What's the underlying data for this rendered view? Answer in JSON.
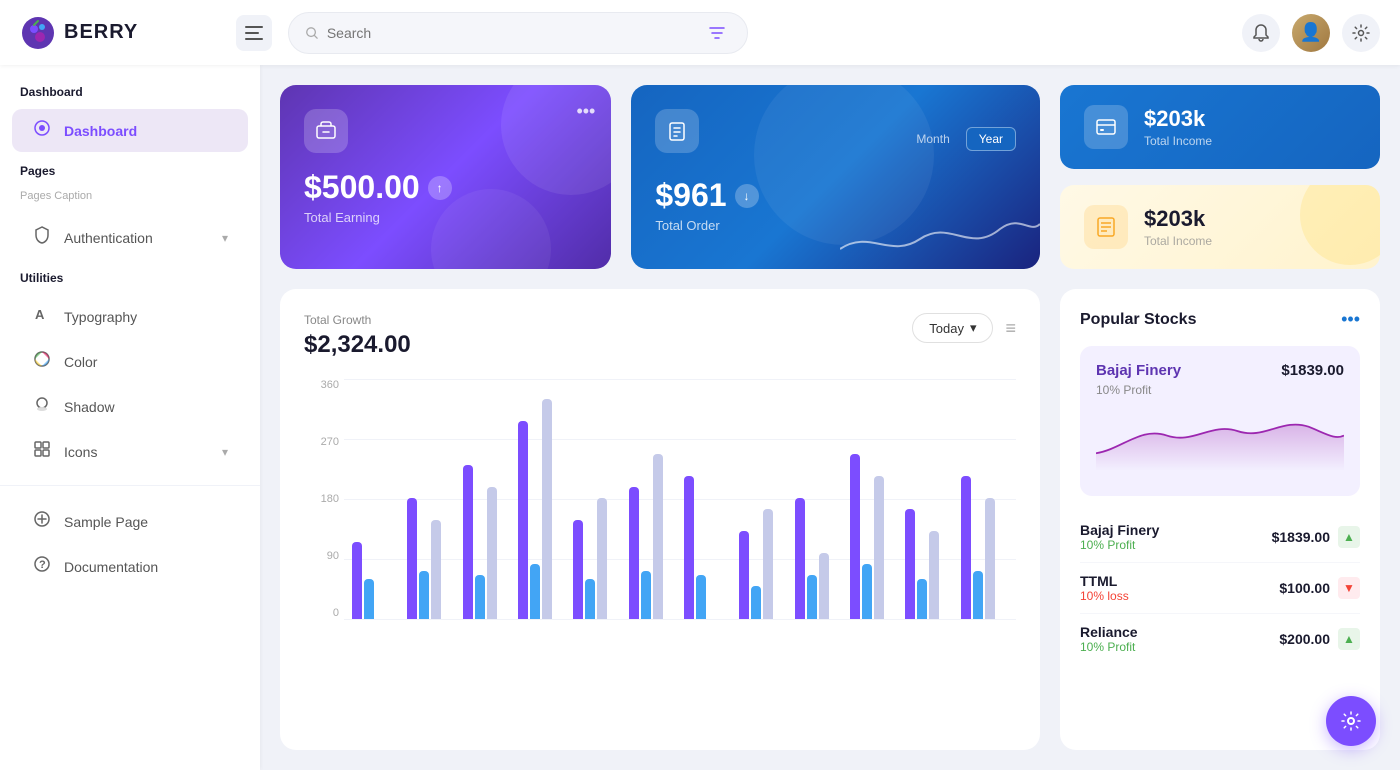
{
  "app": {
    "name": "BERRY",
    "logo_emoji": "🫐"
  },
  "header": {
    "search_placeholder": "Search",
    "menu_label": "☰"
  },
  "sidebar": {
    "dashboard_section": "Dashboard",
    "dashboard_item": "Dashboard",
    "pages_section": "Pages",
    "pages_caption": "Pages Caption",
    "auth_item": "Authentication",
    "utilities_section": "Utilities",
    "typography_item": "Typography",
    "color_item": "Color",
    "shadow_item": "Shadow",
    "icons_item": "Icons",
    "sample_page_item": "Sample Page",
    "documentation_item": "Documentation"
  },
  "cards": {
    "earning_amount": "$500.00",
    "earning_label": "Total Earning",
    "order_amount": "$961",
    "order_label": "Total Order",
    "month_label": "Month",
    "year_label": "Year",
    "income_blue_amount": "$203k",
    "income_blue_label": "Total Income",
    "income_yellow_amount": "$203k",
    "income_yellow_label": "Total Income"
  },
  "chart": {
    "subtitle": "Total Growth",
    "total": "$2,324.00",
    "today_btn": "Today",
    "y_labels": [
      "360",
      "270",
      "180",
      "90"
    ],
    "menu_icon": "≡"
  },
  "stocks": {
    "title": "Popular Stocks",
    "featured_name": "Bajaj Finery",
    "featured_price": "$1839.00",
    "featured_profit": "10% Profit",
    "items": [
      {
        "name": "Bajaj Finery",
        "price": "$1839.00",
        "profit": "10% Profit",
        "trend": "up"
      },
      {
        "name": "TTML",
        "price": "$100.00",
        "profit": "10% loss",
        "trend": "down"
      },
      {
        "name": "Reliance",
        "price": "$200.00",
        "profit": "10% Profit",
        "trend": "up"
      }
    ]
  },
  "bars": [
    {
      "purple": 35,
      "blue": 18,
      "light": 0
    },
    {
      "purple": 55,
      "blue": 22,
      "light": 45
    },
    {
      "purple": 70,
      "blue": 20,
      "light": 60
    },
    {
      "purple": 90,
      "blue": 25,
      "light": 100
    },
    {
      "purple": 45,
      "blue": 18,
      "light": 55
    },
    {
      "purple": 60,
      "blue": 22,
      "light": 75
    },
    {
      "purple": 65,
      "blue": 20,
      "light": 0
    },
    {
      "purple": 40,
      "blue": 15,
      "light": 50
    },
    {
      "purple": 55,
      "blue": 20,
      "light": 30
    },
    {
      "purple": 75,
      "blue": 25,
      "light": 65
    },
    {
      "purple": 50,
      "blue": 18,
      "light": 40
    },
    {
      "purple": 65,
      "blue": 22,
      "light": 55
    }
  ]
}
